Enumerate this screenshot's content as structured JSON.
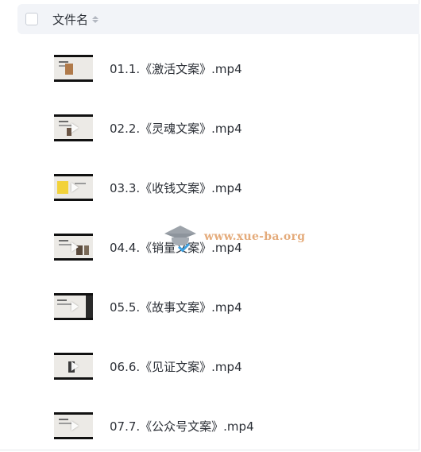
{
  "header": {
    "label": "文件名"
  },
  "files": [
    {
      "name": "01.1.《激活文案》.mp4",
      "thumb": "light"
    },
    {
      "name": "02.2.《灵魂文案》.mp4",
      "thumb": "light"
    },
    {
      "name": "03.3.《收钱文案》.mp4",
      "thumb": "yellow"
    },
    {
      "name": "04.4.《销量文案》.mp4",
      "thumb": "light"
    },
    {
      "name": "05.5.《故事文案》.mp4",
      "thumb": "dark"
    },
    {
      "name": "06.6.《见证文案》.mp4",
      "thumb": "light"
    },
    {
      "name": "07.7.《公众号文案》.mp4",
      "thumb": "light"
    }
  ],
  "watermark": {
    "text": "www.xue-ba.org",
    "color": "#e2a36d"
  },
  "icons": {
    "sort": "sort-icon",
    "play": "play-icon",
    "watermark_logo": "graduation-cap-icon"
  }
}
